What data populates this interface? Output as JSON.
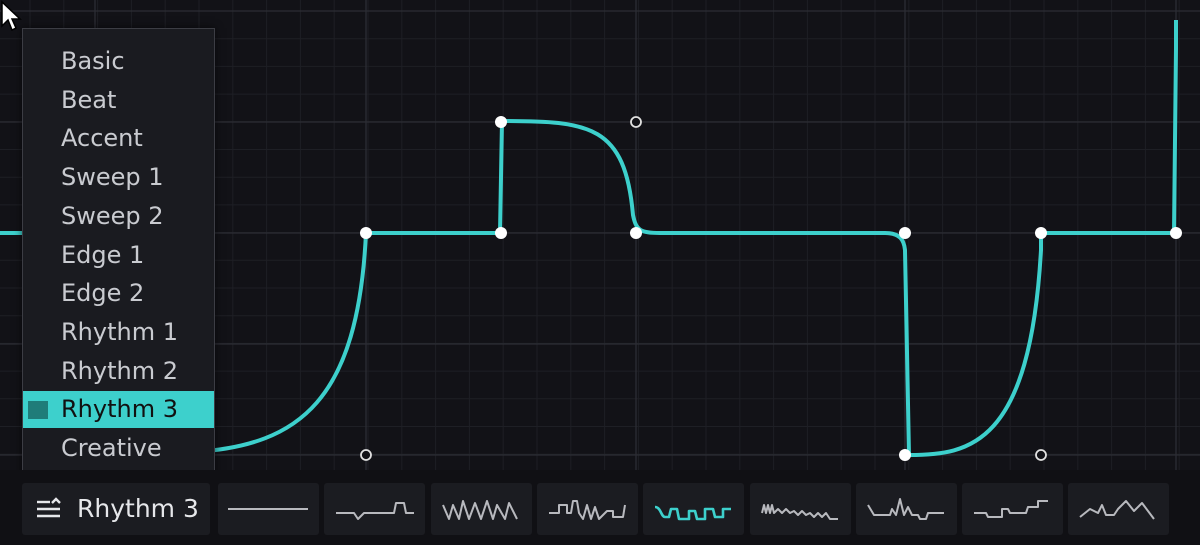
{
  "editor": {
    "curve_color": "#3dd0cc",
    "point_color": "#ffffff"
  },
  "preset_menu": {
    "items": [
      {
        "label": "Basic"
      },
      {
        "label": "Beat"
      },
      {
        "label": "Accent"
      },
      {
        "label": "Sweep 1"
      },
      {
        "label": "Sweep 2"
      },
      {
        "label": "Edge 1"
      },
      {
        "label": "Edge 2"
      },
      {
        "label": "Rhythm 1"
      },
      {
        "label": "Rhythm 2"
      },
      {
        "label": "Rhythm 3",
        "selected": true
      },
      {
        "label": "Creative"
      }
    ],
    "selected_color": "#3dd0cc"
  },
  "toolbar": {
    "preset_icon": "menu-lines-icon",
    "current_preset": "Rhythm 3",
    "shapes": [
      {
        "name": "flat-line-icon"
      },
      {
        "name": "pulse-icon"
      },
      {
        "name": "sawtooth-icon"
      },
      {
        "name": "stepped-wave-icon"
      },
      {
        "name": "rhythm-3-wave-icon",
        "active": true
      },
      {
        "name": "dense-rhythm-icon"
      },
      {
        "name": "spike-wave-icon"
      },
      {
        "name": "steps-icon"
      },
      {
        "name": "ramp-wave-icon"
      }
    ]
  }
}
